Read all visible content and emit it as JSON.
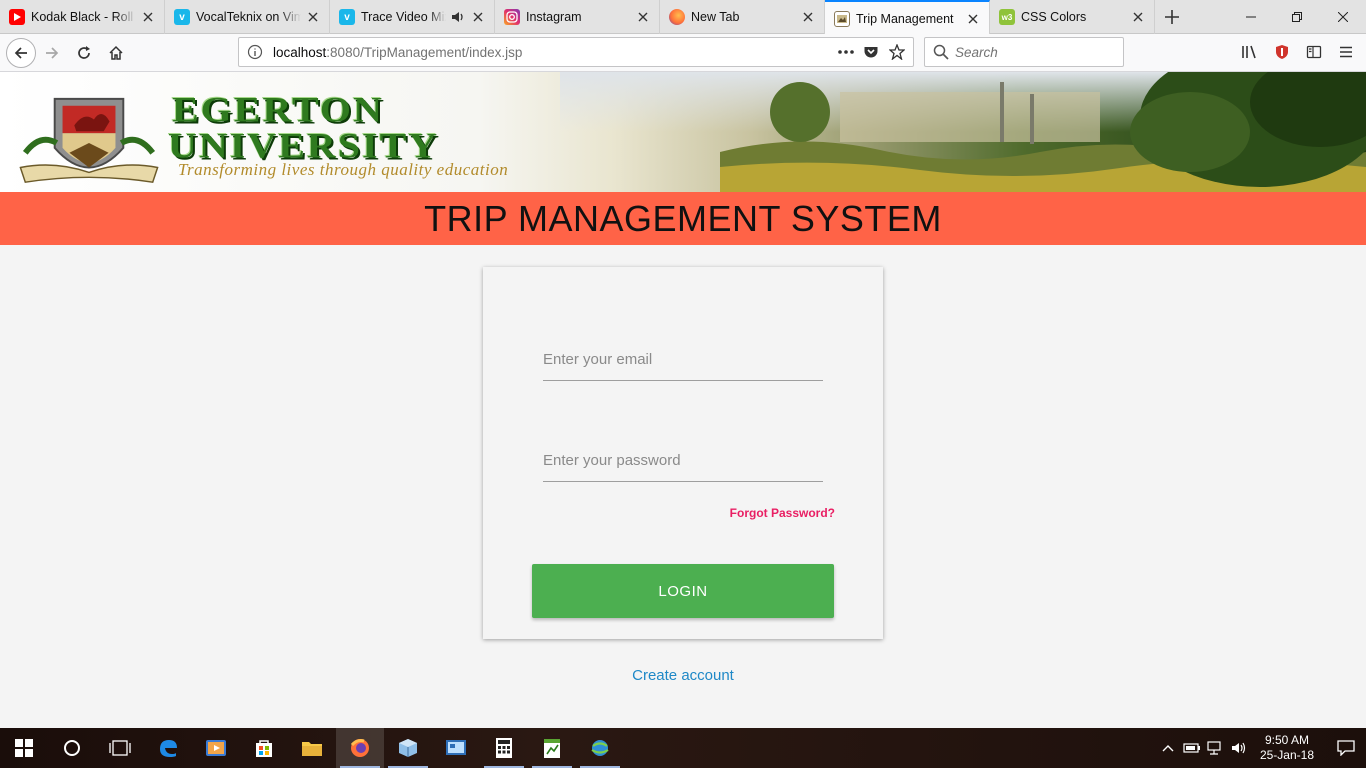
{
  "browser": {
    "tabs": [
      {
        "title": "Kodak Black - Roll In",
        "icon": "youtube-icon",
        "color": "#ff0000",
        "active": false
      },
      {
        "title": "VocalTeknix on Vimeo",
        "icon": "vimeo-icon",
        "color": "#1ab7ea",
        "active": false
      },
      {
        "title": "Trace Video Mix",
        "icon": "vimeo-icon",
        "color": "#1ab7ea",
        "active": false,
        "audio": true
      },
      {
        "title": "Instagram",
        "icon": "instagram-icon",
        "color": "#c13584",
        "active": false
      },
      {
        "title": "New Tab",
        "icon": "firefox-icon",
        "color": "#ff7139",
        "active": false
      },
      {
        "title": "Trip Management",
        "icon": "page-icon",
        "color": "#8a7a5a",
        "active": true
      },
      {
        "title": "CSS Colors",
        "icon": "w3schools-icon",
        "color": "#8fc33a",
        "active": false
      }
    ],
    "url_host": "localhost",
    "url_rest": ":8080/TripManagement/index.jsp",
    "search_placeholder": "Search"
  },
  "banner": {
    "name_line1": "EGERTON",
    "name_line2": "UNIVERSITY",
    "motto": "Transforming lives through quality education"
  },
  "page": {
    "title": "TRIP MANAGEMENT SYSTEM",
    "title_bg": "#ff6347",
    "login": {
      "email_placeholder": "Enter your email",
      "password_placeholder": "Enter your password",
      "forgot_label": "Forgot Password?",
      "login_label": "LOGIN",
      "login_color": "#4caf50",
      "forgot_color": "#e91e63"
    },
    "create_account_label": "Create account"
  },
  "taskbar": {
    "time": "9:50 AM",
    "date": "25-Jan-18"
  }
}
